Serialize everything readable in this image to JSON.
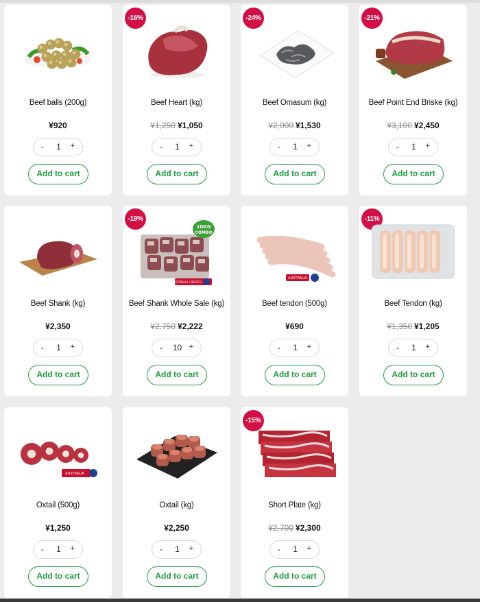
{
  "products": [
    {
      "name": "Beef balls (200g)",
      "badge": "",
      "old_price": "",
      "price": "¥920",
      "qty": "1",
      "cart": "Add to cart",
      "icon": "beef-balls-image"
    },
    {
      "name": "Beef Heart (kg)",
      "badge": "-16%",
      "old_price": "¥1,250",
      "price": "¥1,050",
      "qty": "1",
      "cart": "Add to cart",
      "icon": "beef-heart-image"
    },
    {
      "name": "Beef Omasum (kg)",
      "badge": "-24%",
      "old_price": "¥2,000",
      "price": "¥1,530",
      "qty": "1",
      "cart": "Add to cart",
      "icon": "beef-omasum-image"
    },
    {
      "name": "Beef Point End Briske (kg)",
      "badge": "-21%",
      "old_price": "¥3,100",
      "price": "¥2,450",
      "qty": "1",
      "cart": "Add to cart",
      "icon": "beef-brisket-image"
    },
    {
      "name": "Beef Shank (kg)",
      "badge": "",
      "old_price": "",
      "price": "¥2,350",
      "qty": "1",
      "cart": "Add to cart",
      "icon": "beef-shank-image"
    },
    {
      "name": "Beef Shank Whole Sale (kg)",
      "badge": "-19%",
      "old_price": "¥2,750",
      "price": "¥2,222",
      "qty": "10",
      "cart": "Add to cart",
      "icon": "beef-shank-wholesale-image",
      "combo_label": "10KG COMBO",
      "origin_label": "AUSTRALIA / MEXICO"
    },
    {
      "name": "Beef tendon (500g)",
      "badge": "",
      "old_price": "",
      "price": "¥690",
      "qty": "1",
      "cart": "Add to cart",
      "icon": "beef-tendon-image",
      "origin_label": "AUSTRALIA"
    },
    {
      "name": "Beef Tendon (kg)",
      "badge": "-11%",
      "old_price": "¥1,350",
      "price": "¥1,205",
      "qty": "1",
      "cart": "Add to cart",
      "icon": "beef-tendon-tray-image"
    },
    {
      "name": "Oxtail (500g)",
      "badge": "",
      "old_price": "",
      "price": "¥1,250",
      "qty": "1",
      "cart": "Add to cart",
      "icon": "oxtail-image",
      "origin_label": "AUSTRALIA"
    },
    {
      "name": "Oxtail (kg)",
      "badge": "",
      "old_price": "",
      "price": "¥2,250",
      "qty": "1",
      "cart": "Add to cart",
      "icon": "oxtail-slate-image"
    },
    {
      "name": "Short Plate (kg)",
      "badge": "-15%",
      "old_price": "¥2,700",
      "price": "¥2,300",
      "qty": "1",
      "cart": "Add to cart",
      "icon": "short-plate-image"
    }
  ],
  "qty_controls": {
    "minus": "-",
    "plus": "+"
  },
  "colors": {
    "accent": "#1e9c3f",
    "badge": "#d21046",
    "background": "#ececec"
  }
}
